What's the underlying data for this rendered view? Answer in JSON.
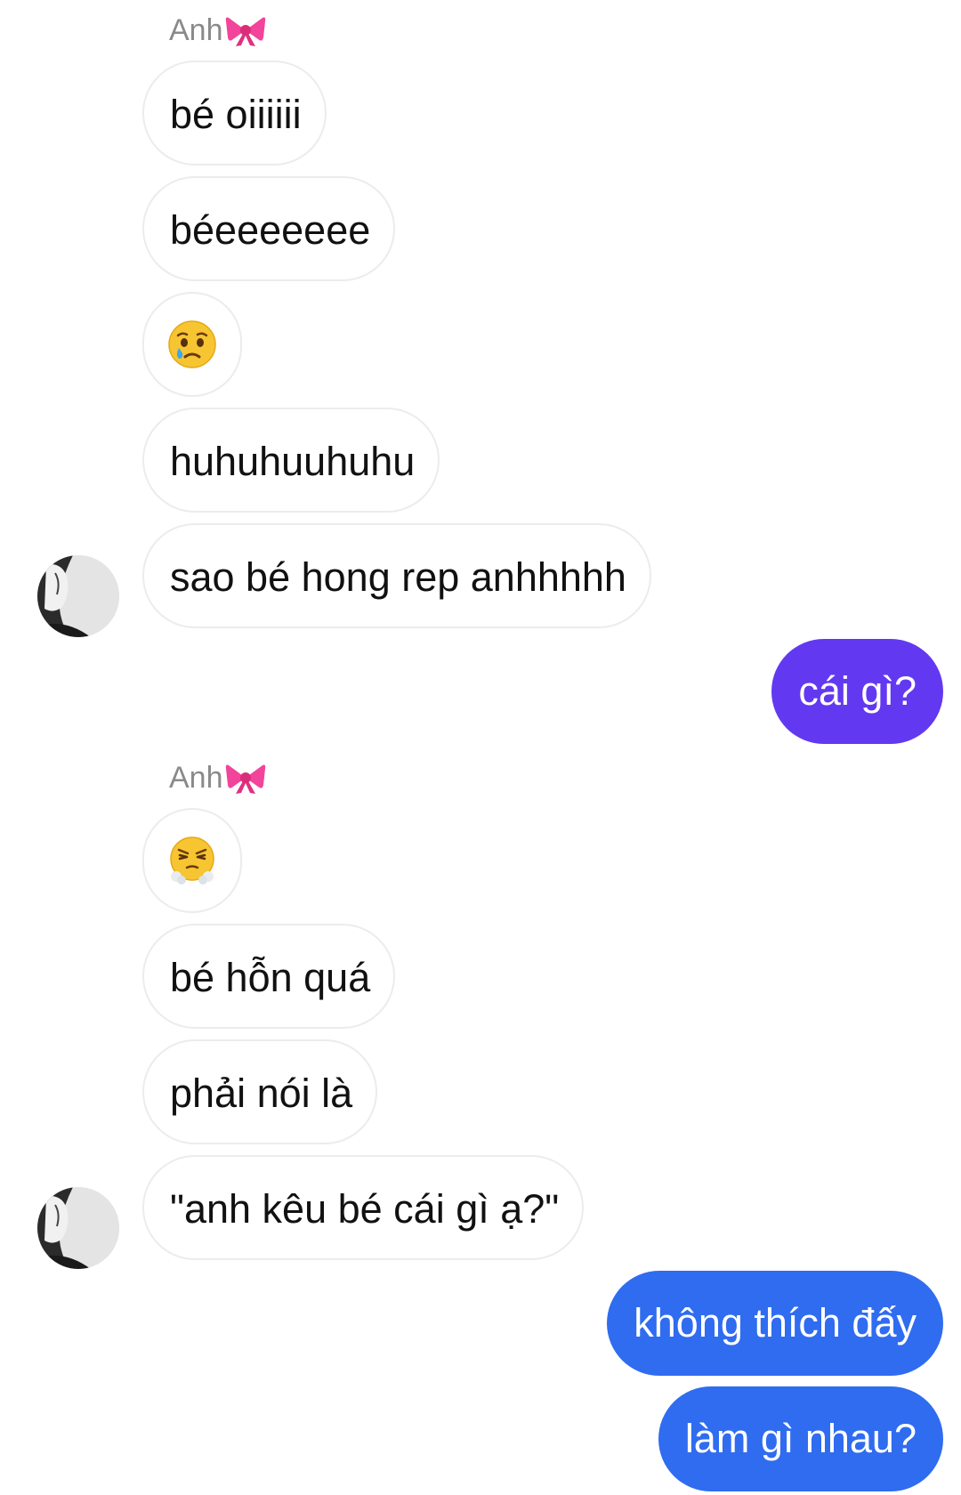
{
  "colors": {
    "incoming_bg": "#ffffff",
    "incoming_border": "#ececec",
    "outgoing_purple": "#6239f0",
    "outgoing_blue": "#2f6cf0",
    "sender_name": "#8a8a8a"
  },
  "groups": [
    {
      "sender": "Anh",
      "sender_icon": "ribbon-emoji",
      "messages": [
        {
          "text": "bé oiiiiii"
        },
        {
          "text": "béeeeeeee"
        },
        {
          "emoji": "crying-face-emoji"
        },
        {
          "text": "huhuhuuhuhu"
        },
        {
          "text": "sao bé hong rep anhhhhh"
        }
      ]
    },
    {
      "sender": "me",
      "messages": [
        {
          "text": "cái gì?",
          "color": "#6239f0"
        }
      ]
    },
    {
      "sender": "Anh",
      "sender_icon": "ribbon-emoji",
      "messages": [
        {
          "emoji": "face-with-steam-emoji"
        },
        {
          "text": "bé hỗn quá"
        },
        {
          "text": "phải nói là"
        },
        {
          "text": "\"anh kêu bé cái gì ạ?\""
        }
      ]
    },
    {
      "sender": "me",
      "messages": [
        {
          "text": "không thích đấy",
          "color": "#2f6cf0"
        },
        {
          "text": "làm gì nhau?",
          "color": "#2f6cf0"
        }
      ]
    }
  ]
}
